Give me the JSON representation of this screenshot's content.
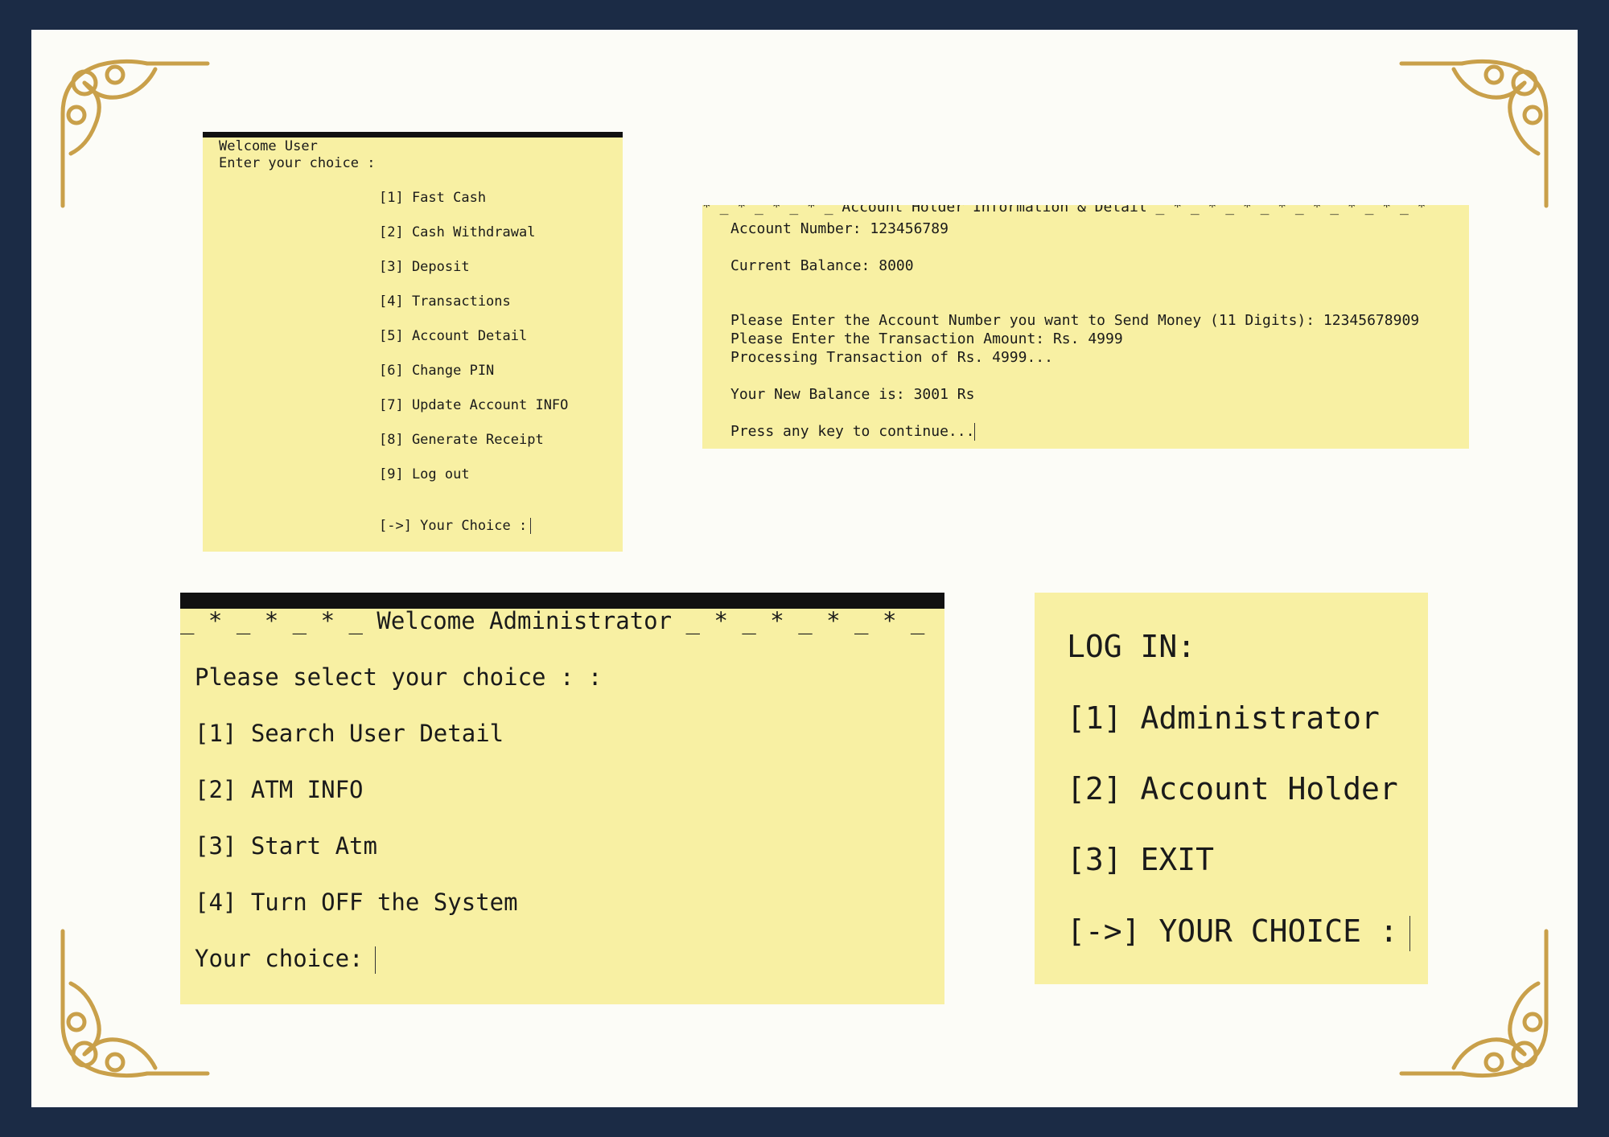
{
  "user_menu": {
    "welcome": "Welcome User",
    "prompt": "Enter your choice :",
    "options": [
      "[1] Fast Cash",
      "[2] Cash Withdrawal",
      "[3] Deposit",
      "[4] Transactions",
      "[5] Account Detail",
      "[6] Change PIN",
      "[7] Update Account INFO",
      "[8] Generate Receipt",
      "[9] Log out"
    ],
    "choice_prompt": "[->] Your Choice :"
  },
  "account_detail": {
    "header": "* _ * _ * _ * _ Account Holder Information & Detail _ * _ * _ * _ * _ * _ * _ * _ *",
    "account_number": "Account Number: 123456789",
    "current_balance": "Current Balance: 8000",
    "send_prompt": "Please Enter the Account Number you want to Send Money (11 Digits): 12345678909",
    "amount_prompt": "Please Enter the Transaction Amount: Rs. 4999",
    "processing": "Processing Transaction of Rs. 4999...",
    "new_balance": "Your New Balance is: 3001 Rs",
    "continue_prompt": "Press any key to continue..."
  },
  "admin_menu": {
    "header": "_ * _ * _ * _ Welcome Administrator _ * _ * _ * _ * _",
    "prompt": "Please select your choice : :",
    "options": [
      "[1] Search User Detail",
      "[2] ATM INFO",
      "[3] Start Atm",
      "[4] Turn OFF the System"
    ],
    "choice_prompt": "Your choice:"
  },
  "login_menu": {
    "title": "LOG IN:",
    "options": [
      "[1] Administrator",
      "[2] Account Holder",
      "[3] EXIT"
    ],
    "choice_prompt": "[->] YOUR CHOICE :"
  },
  "colors": {
    "background": "#1b2b45",
    "sheet": "#fcfcf7",
    "terminal": "#f8f0a3",
    "ornament": "#c9a04a"
  }
}
